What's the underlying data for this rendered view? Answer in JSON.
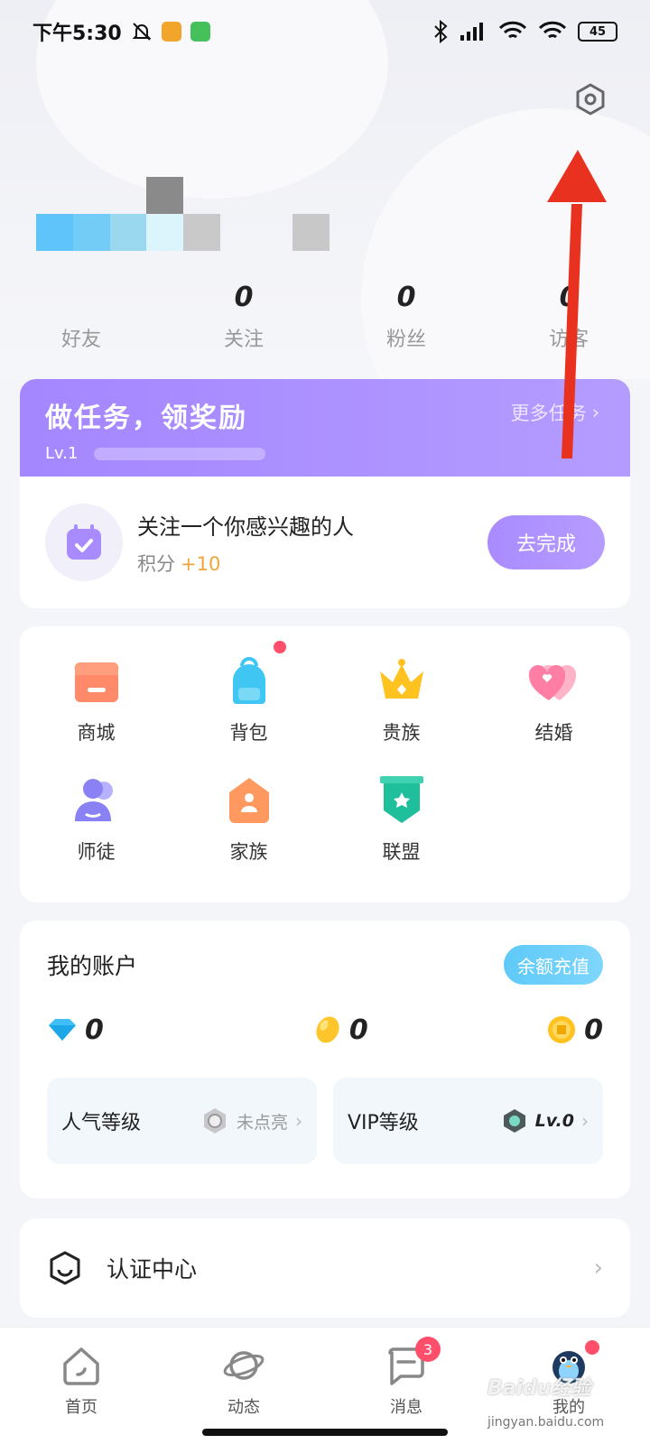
{
  "status_bar": {
    "time": "下午5:30",
    "battery": "45"
  },
  "profile": {
    "stats": [
      {
        "value": "",
        "label": "好友"
      },
      {
        "value": "0",
        "label": "关注"
      },
      {
        "value": "0",
        "label": "粉丝"
      },
      {
        "value": "0",
        "label": "访客"
      }
    ]
  },
  "tasks": {
    "title": "做任务，领奖励",
    "level": "Lv.1",
    "more": "更多任务",
    "item": {
      "name": "关注一个你感兴趣的人",
      "points_label": "积分",
      "points_value": "+10",
      "button": "去完成"
    }
  },
  "features": {
    "row1": [
      {
        "label": "商城",
        "icon": "shop-icon"
      },
      {
        "label": "背包",
        "icon": "backpack-icon"
      },
      {
        "label": "贵族",
        "icon": "crown-icon"
      },
      {
        "label": "结婚",
        "icon": "hearts-icon"
      }
    ],
    "row2": [
      {
        "label": "师徒",
        "icon": "mentor-icon"
      },
      {
        "label": "家族",
        "icon": "family-icon"
      },
      {
        "label": "联盟",
        "icon": "alliance-icon"
      }
    ]
  },
  "account": {
    "title": "我的账户",
    "recharge": "余额充值",
    "diamond": "0",
    "bean": "0",
    "coin": "0",
    "popularity_title": "人气等级",
    "popularity_value": "未点亮",
    "vip_title": "VIP等级",
    "vip_value": "Lv.0"
  },
  "cert": {
    "label": "认证中心"
  },
  "nav": {
    "items": [
      {
        "label": "首页"
      },
      {
        "label": "动态"
      },
      {
        "label": "消息",
        "badge": "3"
      },
      {
        "label": "我的"
      }
    ]
  },
  "watermark": {
    "text": "Baidu经验",
    "url": "jingyan.baidu.com"
  },
  "colors": {
    "task_purple": "#a486ff",
    "recharge_blue": "#5ec9f8",
    "badge_red": "#ff4f6a",
    "points_orange": "#f0a43a",
    "arrow_red": "#e8321f"
  }
}
